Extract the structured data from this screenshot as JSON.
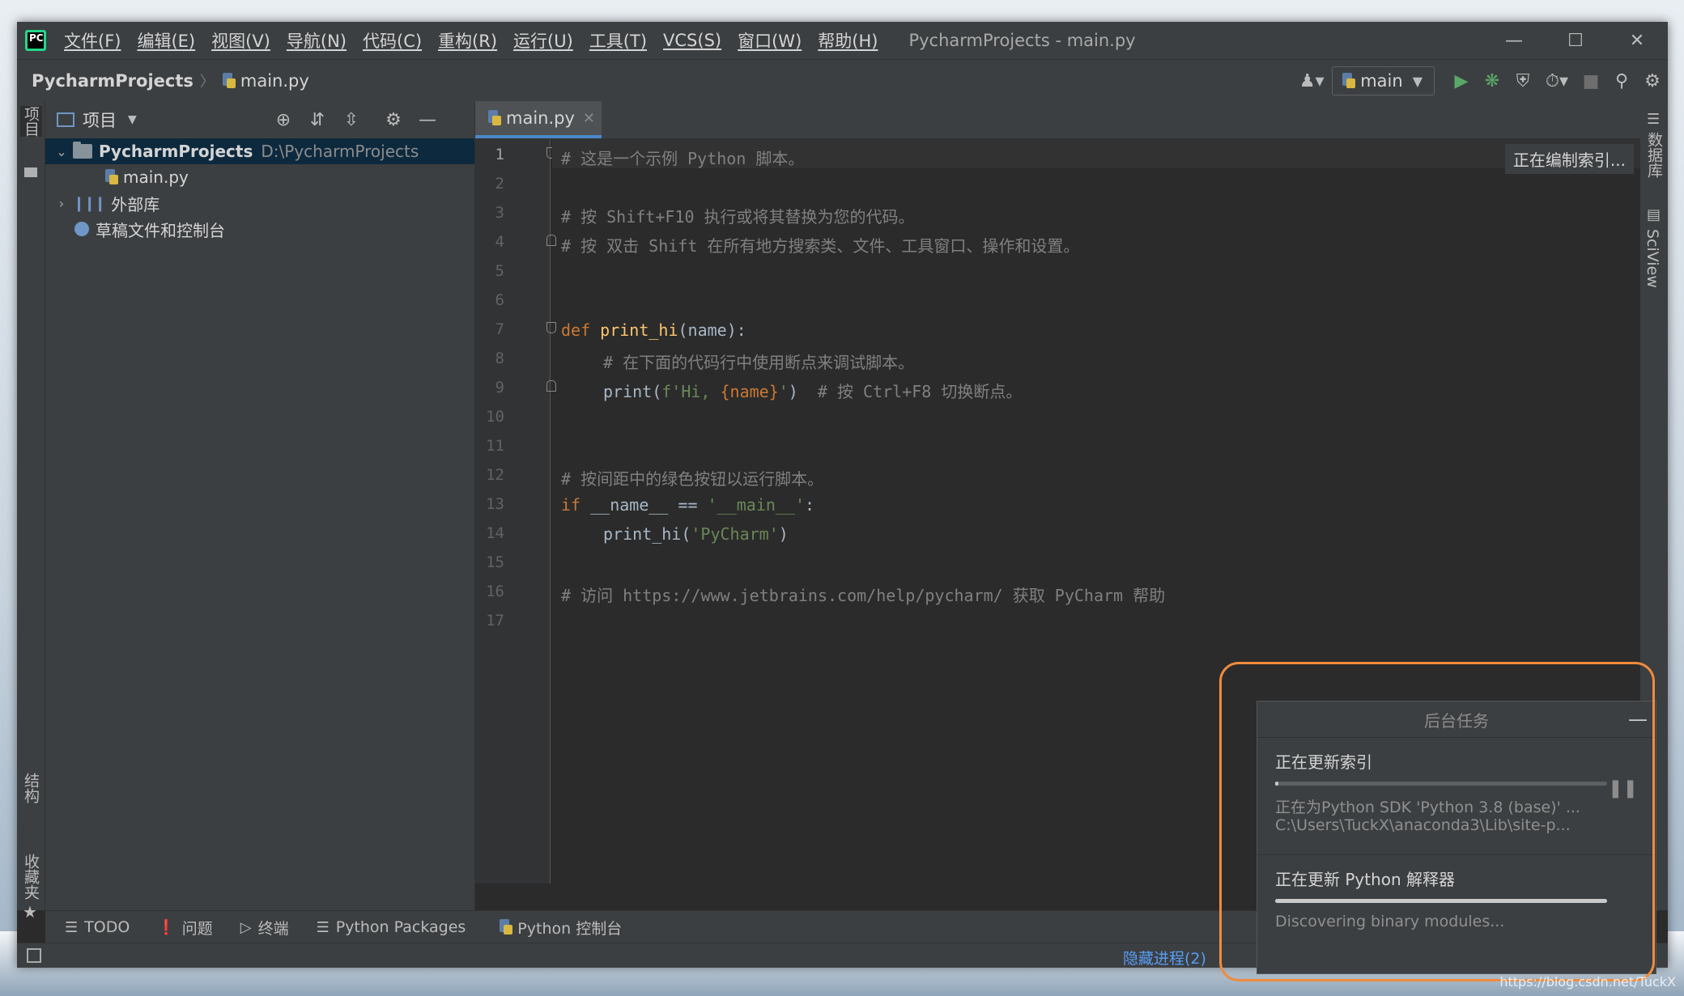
{
  "window": {
    "title": "PycharmProjects - main.py",
    "menu": [
      "文件(F)",
      "编辑(E)",
      "视图(V)",
      "导航(N)",
      "代码(C)",
      "重构(R)",
      "运行(U)",
      "工具(T)",
      "VCS(S)",
      "窗口(W)",
      "帮助(H)"
    ],
    "logo_text": "PC"
  },
  "navbar": {
    "project": "PycharmProjects",
    "file": "main.py",
    "run_config": "main"
  },
  "left_stripe": {
    "project": "项目",
    "structure": "结构",
    "favorites": "收藏夹"
  },
  "right_stripe": {
    "database": "数据库",
    "sciview": "SciView"
  },
  "project_panel": {
    "title": "项目",
    "tree": [
      {
        "name": "PycharmProjects",
        "path": "D:\\PycharmProjects"
      },
      {
        "name": "main.py"
      },
      {
        "name": "外部库"
      },
      {
        "name": "草稿文件和控制台"
      }
    ]
  },
  "editor": {
    "tab": "main.py",
    "indexing_label": "正在编制索引...",
    "line_numbers": [
      "1",
      "2",
      "3",
      "4",
      "5",
      "6",
      "7",
      "8",
      "9",
      "10",
      "11",
      "12",
      "13",
      "14",
      "15",
      "16",
      "17"
    ],
    "lines": {
      "l1": "# 这是一个示例 Python 脚本。",
      "l3": "# 按 Shift+F10 执行或将其替换为您的代码。",
      "l4": "# 按 双击 Shift 在所有地方搜索类、文件、工具窗口、操作和设置。",
      "l7_kw": "def ",
      "l7_fn": "print_hi",
      "l7_rest": "(name):",
      "l8": "# 在下面的代码行中使用断点来调试脚本。",
      "l9_a": "print(",
      "l9_str": "f'Hi, ",
      "l9_var": "{name}",
      "l9_str2": "'",
      "l9_b": ")  ",
      "l9_cm": "# 按 Ctrl+F8 切换断点。",
      "l12": "# 按间距中的绿色按钮以运行脚本。",
      "l13_kw": "if ",
      "l13_a": "__name__ == ",
      "l13_str": "'__main__'",
      "l13_b": ":",
      "l14_a": "print_hi(",
      "l14_str": "'PyCharm'",
      "l14_b": ")",
      "l16": "# 访问 https://www.jetbrains.com/help/pycharm/ 获取 PyCharm 帮助"
    }
  },
  "bottom_tools": [
    "TODO",
    "问题",
    "终端",
    "Python Packages",
    "Python 控制台"
  ],
  "status": {
    "hidden_processes": "隐藏进程(2)"
  },
  "background_tasks": {
    "title": "后台任务",
    "tasks": [
      {
        "title": "正在更新索引",
        "line1": "正在为Python SDK 'Python 3.8 (base)' ...",
        "line2": "C:\\Users\\TuckX\\anaconda3\\Lib\\site-p...",
        "progress": 0.01
      },
      {
        "title": "正在更新 Python 解释器",
        "line1": "Discovering binary modules...",
        "progress": 1.0
      }
    ]
  },
  "watermark": "https://blog.csdn.net/TuckX",
  "colors": {
    "accent": "#4a88c7",
    "highlight": "#f08b3c",
    "run": "#59a869"
  }
}
